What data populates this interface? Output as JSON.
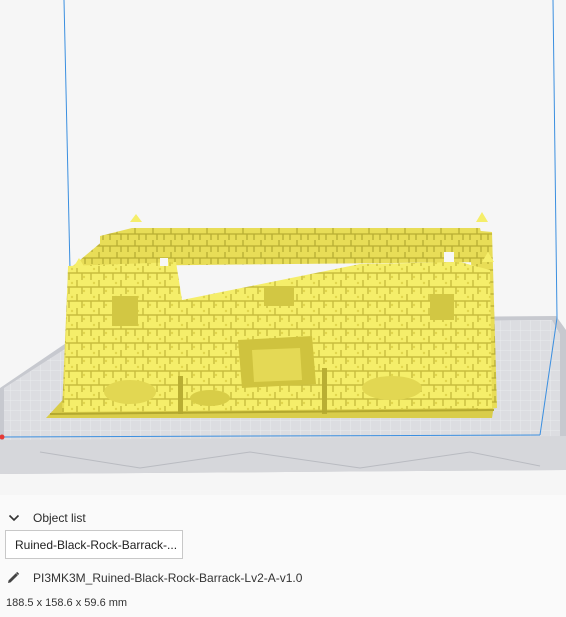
{
  "object_list": {
    "header_label": "Object list",
    "items": [
      {
        "label": "Ruined-Black-Rock-Barrack-..."
      }
    ]
  },
  "selected_object": {
    "file_name": "PI3MK3M_Ruined-Black-Rock-Barrack-Lv2-A-v1.0",
    "dimensions": "188.5 x 158.6 x 59.6 mm"
  },
  "icons": {
    "collapse": "chevron-down-icon",
    "edit": "pencil-icon"
  },
  "colors": {
    "model": "#f5ee6a",
    "model_shadow": "#c8bd3e",
    "build_volume_line": "#3b8fe0",
    "build_plate": "#c4c6cc",
    "grid_line": "#e6e7ea",
    "background": "#f6f6f6"
  }
}
